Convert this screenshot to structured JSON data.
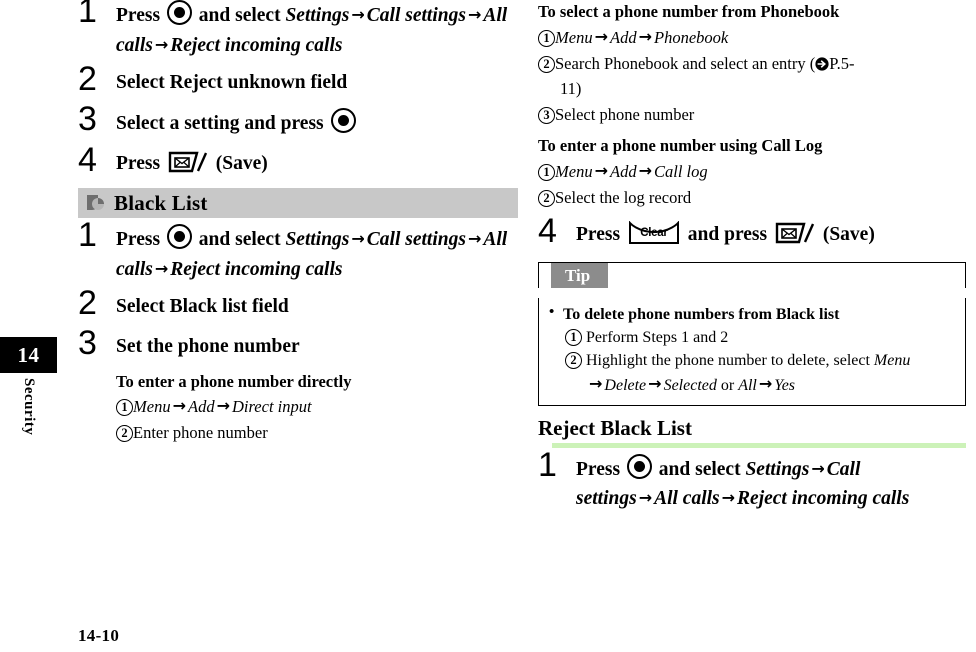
{
  "page": {
    "folio": "14-10",
    "chapter_number": "14",
    "chapter_name": "Security"
  },
  "icons": {
    "center_key": "center-select-key-icon",
    "mail_key": "mail-key-icon",
    "clear_key": "clear-key-icon",
    "clear_key_label": "Clear",
    "xref": "cross-reference-arrow-icon",
    "banner": "section-marker-icon",
    "arrow": "→"
  },
  "left_column": {
    "reject_unknown_steps": [
      {
        "num": "1",
        "pre": "Press ",
        "mid": " and select ",
        "italic_chain": [
          "Settings",
          "Call settings",
          "All calls",
          "Reject incoming calls"
        ]
      },
      {
        "num": "2",
        "text": "Select Reject unknown field"
      },
      {
        "num": "3",
        "pre": "Select a setting and press ",
        "post": ""
      },
      {
        "num": "4",
        "pre": "Press ",
        "post": " (Save)"
      }
    ],
    "section": {
      "title": "Black List",
      "steps": [
        {
          "num": "1",
          "pre": "Press ",
          "mid": " and select ",
          "italic_chain": [
            "Settings",
            "Call settings",
            "All calls",
            "Reject incoming calls"
          ]
        },
        {
          "num": "2",
          "text": "Select Black list field"
        },
        {
          "num": "3",
          "text": "Set the phone number"
        }
      ],
      "sub_direct": {
        "title": "To enter a phone number directly",
        "items": [
          {
            "num": "1",
            "italic": true,
            "chain": [
              "Menu",
              "Add",
              "Direct input"
            ]
          },
          {
            "num": "2",
            "italic": false,
            "text": "Enter phone number"
          }
        ]
      }
    }
  },
  "right_column": {
    "sub_phonebook": {
      "title": "To select a phone number from Phonebook",
      "items": [
        {
          "num": "1",
          "italic": true,
          "chain": [
            "Menu",
            "Add",
            "Phonebook"
          ]
        },
        {
          "num": "2",
          "italic": false,
          "text_before": "Search Phonebook and select an entry (",
          "xref": "P.5-",
          "continuation": "11)"
        },
        {
          "num": "3",
          "italic": false,
          "text": "Select phone number"
        }
      ]
    },
    "sub_calllog": {
      "title": "To enter a phone number using Call Log",
      "items": [
        {
          "num": "1",
          "italic": true,
          "chain": [
            "Menu",
            "Add",
            "Call log"
          ]
        },
        {
          "num": "2",
          "italic": false,
          "text": "Select the log record"
        }
      ]
    },
    "step4": {
      "num": "4",
      "pre": "Press ",
      "mid": " and press ",
      "post": " (Save)"
    },
    "tip": {
      "label": "Tip",
      "bullet": "To delete phone numbers from Black list",
      "items": [
        {
          "num": "1",
          "text": "Perform Steps 1 and 2"
        },
        {
          "num": "2",
          "text_before": "Highlight the phone number to delete, select ",
          "italic_first": "Menu",
          "continuation_chain": [
            "Delete",
            "Selected"
          ],
          "or_word": " or ",
          "continuation_tail": [
            "All",
            "Yes"
          ]
        }
      ]
    },
    "reject_black": {
      "title": "Reject Black List",
      "steps": [
        {
          "num": "1",
          "pre": "Press ",
          "mid": " and select ",
          "italic_chain": [
            "Settings",
            "Call settings",
            "All calls",
            "Reject incoming calls"
          ]
        }
      ]
    }
  },
  "colors": {
    "banner_gray": "#c8c8c8",
    "tip_gray": "#8c8c8c",
    "green_rule": "#ccf2b8",
    "tab_black": "#000000"
  }
}
